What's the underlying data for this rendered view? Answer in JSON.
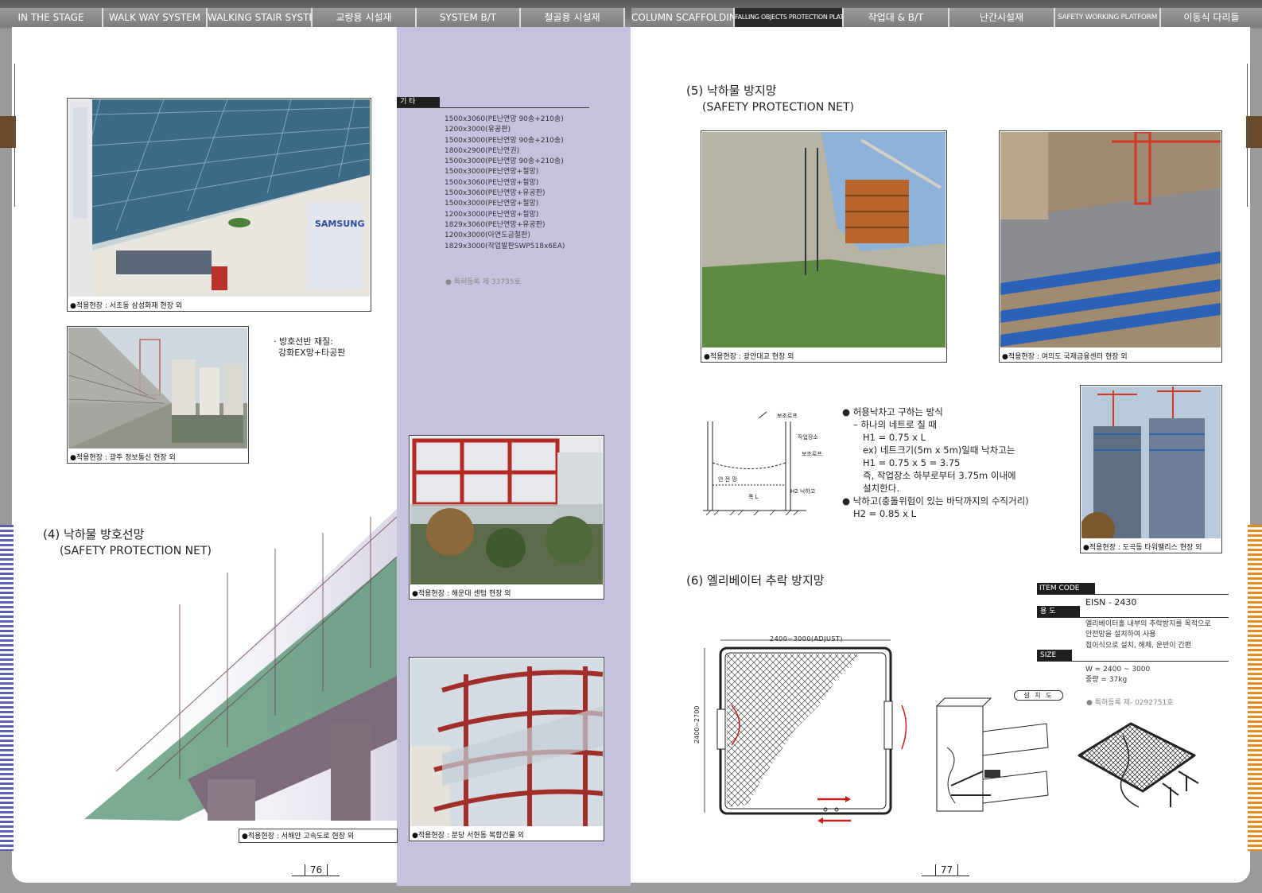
{
  "tabs": [
    {
      "label": "IN THE STAGE"
    },
    {
      "label": "WALK WAY SYSTEM"
    },
    {
      "label": "WALKING STAIR SYSTEM"
    },
    {
      "label": "교량용 시설재"
    },
    {
      "label": "SYSTEM B/T"
    },
    {
      "label": "철골용 시설재"
    },
    {
      "label": "COLUMN SCAFFOLDING"
    },
    {
      "label": "FALLING OBJECTS PROTECTION PLATFORM"
    },
    {
      "label": "작업대 & B/T"
    },
    {
      "label": "난간시설재"
    },
    {
      "label": "SAFETY WORKING PLATFORM"
    },
    {
      "label": "이동식 다리들"
    }
  ],
  "left_page": {
    "photo1_caption": "●적용현장 : 서초동 삼성화재 현장 외",
    "photo2_caption": "●적용현장 : 광주 정보통신 현장 외",
    "material_note": [
      "· 방호선반 재질:",
      "강화EX망+타공판"
    ],
    "section4_title": "(4) 낙하물 방호선망",
    "section4_subtitle": "(SAFETY PROTECTION NET)",
    "photo3_caption": "●적용현장 : 서해안 고속도로 현장 외",
    "photo4_caption": "●적용현장 : 해운대 센텀 현장 외",
    "photo5_caption": "●적용현장 : 분당 서현동 복합건물 외",
    "others_label": "기 타",
    "spec_list": [
      "1500x3060(PE난연망 90송+210송)",
      "1200x3000(유공판)",
      "1500x3000(PE난연망 90송+210송)",
      "1800x2900(PE난연권)",
      "1500x3000(PE난연망 90송+210송)",
      "1500x3000(PE난연망+철망)",
      "1500x3060(PE난연망+철망)",
      "1500x3060(PE난연망+유공판)",
      "1500x3000(PE난연망+철망)",
      "1200x3000(PE난연망+철망)",
      "1829x3060(PE난연망+유공판)",
      "1200x3000(아연도금철판)",
      "1829x3000(작업발판SWP518x6EA)"
    ],
    "patent": "● 특허등록 제 33735호",
    "page_number": "76"
  },
  "right_page": {
    "section5_title": "(5) 낙하물 방지망",
    "section5_subtitle": "(SAFETY PROTECTION NET)",
    "photo6_caption": "●적용현장 : 광안대교 현장 외",
    "photo7_caption": "●적용현장 : 여의도 국제금융센터 현장 외",
    "photo8_caption": "●적용현장 : 도곡동 타워팰리스 현장 외",
    "diagram_labels": {
      "rope1": "보조로프",
      "work": "작업장소",
      "rope2": "보조로프",
      "net": "안 전 망",
      "drop": "H2 낙하고",
      "width": "폭 L"
    },
    "method_lines": [
      "● 허용낙차고 구하는 방식",
      "– 하나의 네트로 칠 때",
      "H1 = 0.75 x L",
      "ex) 네트크기(5m x 5m)일때 낙차고는",
      "H1 = 0.75 x 5 = 3.75",
      "즉, 작업장소 하부로부터 3.75m 이내에",
      "설치한다.",
      "● 낙하고(충돌위험이 있는 바닥까지의 수직거리)",
      "H2 = 0.85 x L"
    ],
    "section6_title": "(6) 엘리베이터 추락 방지망",
    "item_code_label": "ITEM CODE",
    "item_code": "EISN - 2430",
    "usage_label": "용 도",
    "usage_lines": [
      "엘리베이터홀 내부의 추락방지를 목적으로",
      "안전망을 설치하여 사용",
      "접이식으로 설치, 해체, 운반이 간편"
    ],
    "size_label": "SIZE",
    "size_lines": [
      "W = 2400 ~ 3000",
      "중량 = 37kg"
    ],
    "patent": "● 특허등록 제- 0292751호",
    "dim_width": "2400~3000(ADJUST)",
    "dim_height": "2400~2700",
    "install_label": "설 치 도",
    "page_number": "77"
  }
}
